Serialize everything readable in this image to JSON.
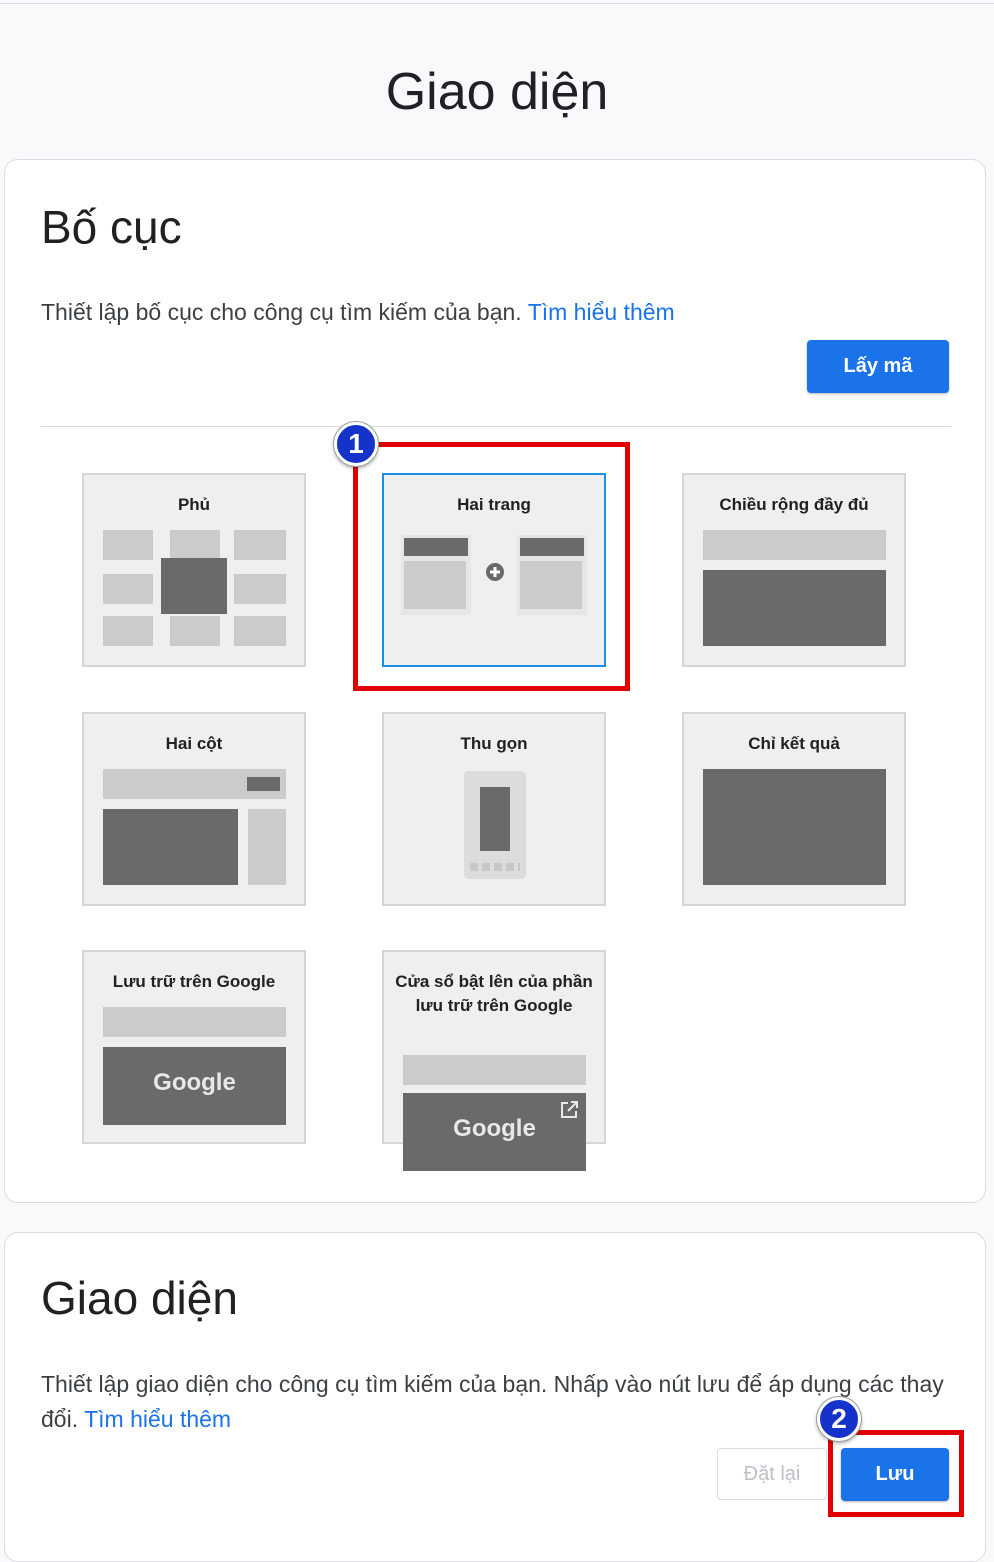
{
  "page": {
    "title": "Giao diện"
  },
  "layout_section": {
    "title": "Bố cục",
    "description": "Thiết lập bố cục cho công cụ tìm kiếm của bạn.",
    "learn_more": "Tìm hiểu thêm",
    "get_code_label": "Lấy mã",
    "options": [
      {
        "label": "Phủ",
        "selected": false
      },
      {
        "label": "Hai trang",
        "selected": true
      },
      {
        "label": "Chiều rộng đầy đủ",
        "selected": false
      },
      {
        "label": "Hai cột",
        "selected": false
      },
      {
        "label": "Thu gọn",
        "selected": false
      },
      {
        "label": "Chỉ kết quả",
        "selected": false
      },
      {
        "label": "Lưu trữ trên Google",
        "selected": false
      },
      {
        "label": "Cửa sổ bật lên của phần lưu trữ trên Google",
        "selected": false
      }
    ],
    "google_logo_text": "Google"
  },
  "theme_section": {
    "title": "Giao diện",
    "description": "Thiết lập giao diện cho công cụ tìm kiếm của bạn. Nhấp vào nút lưu để áp dụng các thay đổi.",
    "learn_more": "Tìm hiểu thêm",
    "reset_label": "Đặt lại",
    "save_label": "Lưu"
  },
  "annotations": {
    "badge1": "1",
    "badge2": "2"
  },
  "colors": {
    "accent": "#1a73e8",
    "highlight": "#e00000",
    "badge": "#1533c8"
  }
}
